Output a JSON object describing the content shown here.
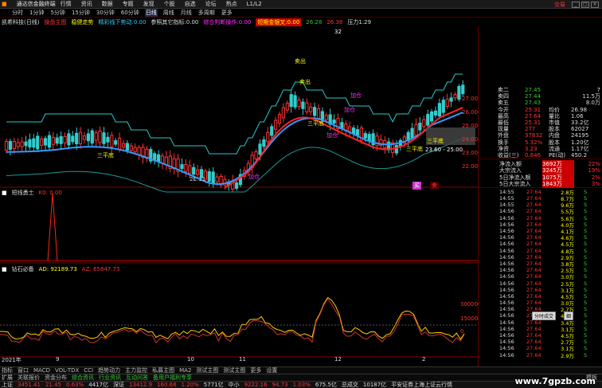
{
  "menu": {
    "app": "通达信金融终端",
    "items": [
      "行情",
      "资讯",
      "数据",
      "专题",
      "发现",
      "个股",
      "自选",
      "论坛",
      "热点",
      "L1/L2"
    ],
    "account": "交易"
  },
  "periods": [
    "分时",
    "1分钟",
    "5分钟",
    "15分钟",
    "30分钟",
    "60分钟",
    "日线",
    "周线",
    "月线",
    "多周期",
    "更多"
  ],
  "periods_active": "日线",
  "info": {
    "stock": "凯希科技(日线)",
    "s1": "操盘主图",
    "s2": "稳健走势",
    "s3": "精彩线下势动:0.00",
    "s4": "参照其它指标:0.00",
    "s5": "综合判断操作:0.00",
    "s6": "短期金银叉:0.00",
    "v1": "26.28",
    "v2": "26.38",
    "v3": "压力1:29"
  },
  "chart_labels": {
    "sanping1": "三平底",
    "sanping2": "三平底",
    "sanping3": "三平底",
    "jiacang1": "加仓",
    "jiacang2": "加仓",
    "jiacang3": "加仓",
    "jiacang4": "加仓",
    "low": "21.11",
    "range": "23.60 - 25.00",
    "buy": "买",
    "sell": "卖",
    "top": "32",
    "maishu1": "卖出",
    "maishu2": "卖出"
  },
  "price_scale": [
    "27.00",
    "26.00",
    "25.00",
    "24.00",
    "23.00",
    "22.00"
  ],
  "sub1": {
    "name": "短线勇士",
    "val": "K0: 0.00"
  },
  "sub2": {
    "name": "钻石必备",
    "ad": "AD: 92189.73",
    "az": "AZ: 65847.73"
  },
  "sub2_scale": [
    "30000",
    "15000",
    "0"
  ],
  "date_marks": [
    "2021年",
    "9",
    "10",
    "11",
    "12",
    "2"
  ],
  "quote": {
    "rows": [
      {
        "l": "卖二",
        "v": "27.45",
        "n": "7"
      },
      {
        "l": "卖四",
        "v": "27.44",
        "n": "11.5万"
      },
      {
        "l": "卖五",
        "v": "27.43",
        "n": "8.0万"
      },
      {
        "l": "今开",
        "v": "25.31",
        "l2": "均价",
        "v2": "26.98"
      },
      {
        "l": "最高",
        "v": "27.64",
        "l2": "量比",
        "v2": "1.06"
      },
      {
        "l": "最低",
        "v": "25.31",
        "l2": "市值",
        "v2": "33.2亿"
      },
      {
        "l": "现量",
        "v": "277",
        "l2": "股本",
        "v2": "62027"
      },
      {
        "l": "外盘",
        "v": "37832",
        "l2": "内盘",
        "v2": "24195"
      },
      {
        "l": "换手",
        "v": "5.32%",
        "l2": "股本",
        "v2": "1.20亿"
      },
      {
        "l": "净资",
        "v": "3.23",
        "l2": "流通",
        "v2": "1.17亿"
      },
      {
        "l": "收益(三)",
        "v": "0.846",
        "l2": "PE(动)",
        "v2": "450.2"
      }
    ],
    "flow": [
      {
        "l": "净流入额",
        "v": "3692万",
        "p": "22%"
      },
      {
        "l": "大宗流入",
        "v": "3245万",
        "p": "19%"
      },
      {
        "l": "5日净流入额",
        "v": "1075万",
        "p": "2%"
      },
      {
        "l": "5日大宗流入",
        "v": "1843万",
        "p": "3%"
      }
    ],
    "ticks": [
      {
        "t": "14:55",
        "p": "27.64",
        "v": "2.8万",
        "s": "S"
      },
      {
        "t": "14:55",
        "p": "27.64",
        "v": "8.7万",
        "s": "S"
      },
      {
        "t": "14:55",
        "p": "27.64",
        "v": "9.6万",
        "s": "S"
      },
      {
        "t": "14:56",
        "p": "27.64",
        "v": "5.5万",
        "s": "S"
      },
      {
        "t": "14:56",
        "p": "27.64",
        "v": "5.6万",
        "s": "S"
      },
      {
        "t": "14:56",
        "p": "27.64",
        "v": "4.0万",
        "s": "S"
      },
      {
        "t": "14:56",
        "p": "27.64",
        "v": "4.1万",
        "s": "S"
      },
      {
        "t": "14:56",
        "p": "27.64",
        "v": "4.6万",
        "s": "S"
      },
      {
        "t": "14:56",
        "p": "27.64",
        "v": "4.5万",
        "s": "S"
      },
      {
        "t": "14:56",
        "p": "27.64",
        "v": "4.8万",
        "s": "S"
      },
      {
        "t": "14:56",
        "p": "27.64",
        "v": "2.9万",
        "s": "S"
      },
      {
        "t": "14:56",
        "p": "27.64",
        "v": "3.8万",
        "s": "S"
      },
      {
        "t": "14:56",
        "p": "27.64",
        "v": "2.5万",
        "s": "S"
      },
      {
        "t": "14:56",
        "p": "27.64",
        "v": "3.0万",
        "s": "S"
      },
      {
        "t": "14:56",
        "p": "27.64",
        "v": "2.5万",
        "s": "S"
      },
      {
        "t": "14:56",
        "p": "27.64",
        "v": "3.1万",
        "s": "S"
      },
      {
        "t": "14:56",
        "p": "27.64",
        "v": "4.5万",
        "s": "S"
      },
      {
        "t": "14:56",
        "p": "27.64",
        "v": "3.0万",
        "s": "S"
      },
      {
        "t": "14:56",
        "p": "27.64",
        "v": "2.7万",
        "s": "S"
      },
      {
        "t": "14:56",
        "p": "27.64",
        "v": "4.0万",
        "s": "S"
      },
      {
        "t": "14:56",
        "p": "27.64",
        "v": "3.4万",
        "s": "S"
      },
      {
        "t": "14:56",
        "p": "27.64",
        "v": "3.1万",
        "s": "S"
      },
      {
        "t": "14:56",
        "p": "27.64",
        "v": "4.5万",
        "s": "S"
      },
      {
        "t": "14:56",
        "p": "27.64",
        "v": "2.7万",
        "s": "S"
      },
      {
        "t": "14:56",
        "p": "27.64",
        "v": "3.1万",
        "s": "S"
      },
      {
        "t": "14:56",
        "p": "27.64",
        "v": "2.9万",
        "s": "S"
      }
    ],
    "btn1": "分时成交",
    "btn2": "细"
  },
  "tabs": [
    "指标",
    "窗口",
    "MACD",
    "VOL-TDX",
    "CCI",
    "趋势动力",
    "主力监控",
    "私募主图",
    "MA2",
    "测试主图",
    "测试主图",
    "更多",
    "设置"
  ],
  "tabs2": [
    "扩展",
    "关联报价",
    "资金分布",
    "综合资讯",
    "行业资讯",
    "互动问答",
    "备用户福利专享"
  ],
  "tabs_right": "模板",
  "bottom": {
    "sh": "上证",
    "sh_v": "3451.41",
    "sh_c": "21.45",
    "sh_p": "0.63%",
    "sh_a": "4417亿",
    "sz": "深证",
    "sz_v": "13412.9",
    "sz_c": "160.68",
    "sz_p": "1.20%",
    "sz_a": "5771亿",
    "zx": "中小",
    "zx_v": "9222.16",
    "zx_c": "94.73",
    "zx_p": "1.03%",
    "zx_a": "675.5亿",
    "zc": "总成交",
    "zc_v": "10187亿",
    "news": "平安证券上海上证云行情"
  },
  "watermark": "www.7gpzb.com",
  "colors": {
    "up": "#ff3333",
    "down": "#33cccc",
    "ma_blue": "#3399ff",
    "ma_red": "#ff2222",
    "ma_cyan": "#22cccc",
    "yellow": "#ffff00"
  }
}
